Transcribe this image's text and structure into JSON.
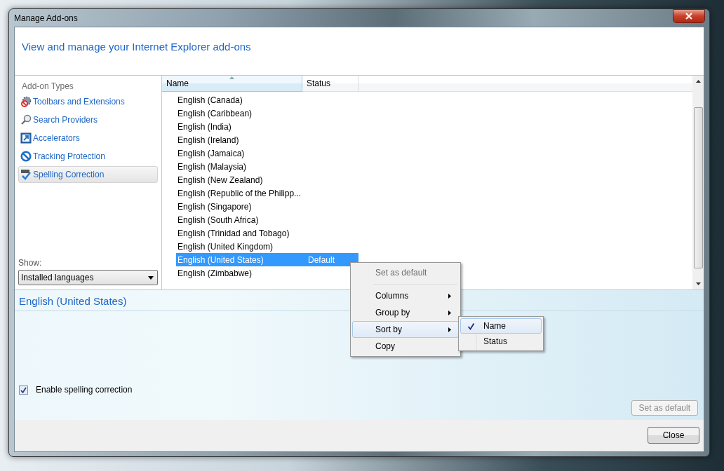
{
  "window": {
    "title": "Manage Add-ons"
  },
  "header": {
    "title": "View and manage your Internet Explorer add-ons"
  },
  "sidebar": {
    "heading": "Add-on Types",
    "items": [
      {
        "label": "Toolbars and Extensions",
        "selected": false
      },
      {
        "label": "Search Providers",
        "selected": false
      },
      {
        "label": "Accelerators",
        "selected": false
      },
      {
        "label": "Tracking Protection",
        "selected": false
      },
      {
        "label": "Spelling Correction",
        "selected": true
      }
    ],
    "show_label": "Show:",
    "show_value": "Installed languages"
  },
  "list": {
    "columns": [
      "Name",
      "Status"
    ],
    "rows": [
      {
        "name": "English (Canada)",
        "status": "",
        "selected": false
      },
      {
        "name": "English (Caribbean)",
        "status": "",
        "selected": false
      },
      {
        "name": "English (India)",
        "status": "",
        "selected": false
      },
      {
        "name": "English (Ireland)",
        "status": "",
        "selected": false
      },
      {
        "name": "English (Jamaica)",
        "status": "",
        "selected": false
      },
      {
        "name": "English (Malaysia)",
        "status": "",
        "selected": false
      },
      {
        "name": "English (New Zealand)",
        "status": "",
        "selected": false
      },
      {
        "name": "English (Republic of the Philipp...",
        "status": "",
        "selected": false
      },
      {
        "name": "English (Singapore)",
        "status": "",
        "selected": false
      },
      {
        "name": "English (South Africa)",
        "status": "",
        "selected": false
      },
      {
        "name": "English (Trinidad and Tobago)",
        "status": "",
        "selected": false
      },
      {
        "name": "English (United Kingdom)",
        "status": "",
        "selected": false
      },
      {
        "name": "English (United States)",
        "status": "Default",
        "selected": true
      },
      {
        "name": "English (Zimbabwe)",
        "status": "",
        "selected": false
      }
    ]
  },
  "details": {
    "title": "English (United States)",
    "checkbox": {
      "label": "Enable spelling correction",
      "checked": true
    },
    "default_button": {
      "label": "Set as default",
      "disabled": true
    }
  },
  "footer": {
    "close_button": "Close"
  },
  "context_menu": {
    "items": [
      {
        "kind": "item",
        "label": "Set as default",
        "disabled": true,
        "submenu": false,
        "selected": false
      },
      {
        "kind": "separator"
      },
      {
        "kind": "item",
        "label": "Columns",
        "disabled": false,
        "submenu": true,
        "selected": false
      },
      {
        "kind": "item",
        "label": "Group by",
        "disabled": false,
        "submenu": true,
        "selected": false
      },
      {
        "kind": "item",
        "label": "Sort by",
        "disabled": false,
        "submenu": true,
        "selected": true
      },
      {
        "kind": "item",
        "label": "Copy",
        "disabled": false,
        "submenu": false,
        "selected": false
      }
    ],
    "submenu": [
      {
        "label": "Name",
        "checked": true,
        "selected": true
      },
      {
        "label": "Status",
        "checked": false,
        "selected": false
      }
    ]
  }
}
